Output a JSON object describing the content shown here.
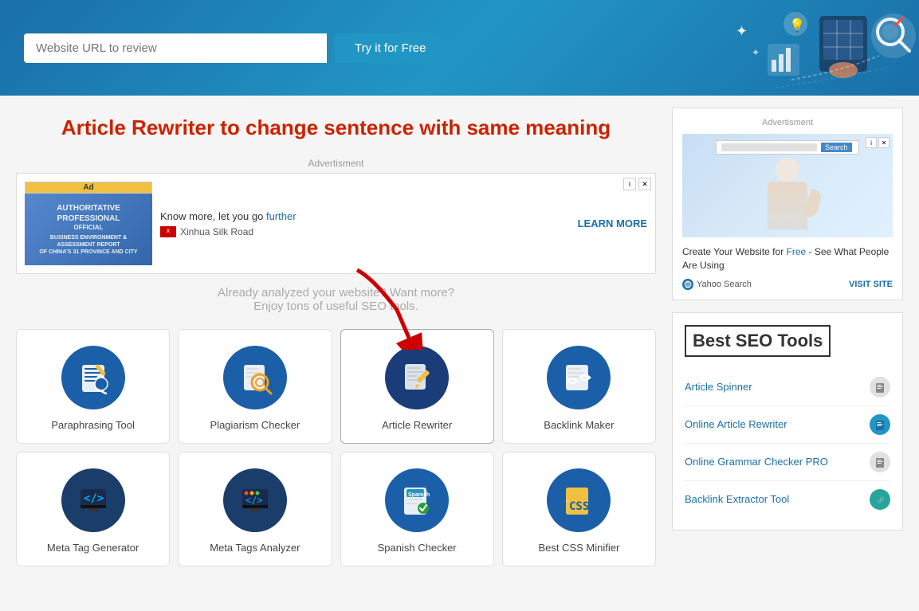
{
  "header": {
    "url_placeholder": "Website URL to review",
    "try_btn": "Try it for Free"
  },
  "page": {
    "title": "Article Rewriter to change sentence with same meaning",
    "ad_label": "Advertisment",
    "ad_text_line1": "Know more, let you go further",
    "ad_text_line1_link": "further",
    "ad_source": "Xinhua Silk Road",
    "ad_learn_more": "LEARN MORE",
    "desc_line1": "Already analyzed your website? Want more?",
    "desc_line2": "Enjoy tons of useful SEO tools."
  },
  "tools": [
    {
      "label": "Paraphrasing Tool",
      "icon_type": "paraphrase"
    },
    {
      "label": "Plagiarism Checker",
      "icon_type": "plagiarism"
    },
    {
      "label": "Article Rewriter",
      "icon_type": "rewriter"
    },
    {
      "label": "Backlink Maker",
      "icon_type": "backlink"
    },
    {
      "label": "Meta Tag Generator",
      "icon_type": "metatag"
    },
    {
      "label": "Meta Tags Analyzer",
      "icon_type": "metataganalyzer"
    },
    {
      "label": "Spanish Checker",
      "icon_type": "spanish"
    },
    {
      "label": "Best CSS Minifier",
      "icon_type": "css"
    }
  ],
  "sidebar": {
    "ad_label": "Advertisment",
    "ad_desc": "Create Your Website for Free - See What People Are Using",
    "ad_source": "Yahoo Search",
    "visit_site": "VISIT SITE",
    "seo_title": "Best SEO Tools",
    "seo_items": [
      {
        "label": "Article Spinner",
        "badge_type": "gray"
      },
      {
        "label": "Online Article Rewriter",
        "badge_type": "blue"
      },
      {
        "label": "Online Grammar Checker PRO",
        "badge_type": "gray"
      },
      {
        "label": "Backlink Extractor Tool",
        "badge_type": "teal"
      }
    ]
  }
}
